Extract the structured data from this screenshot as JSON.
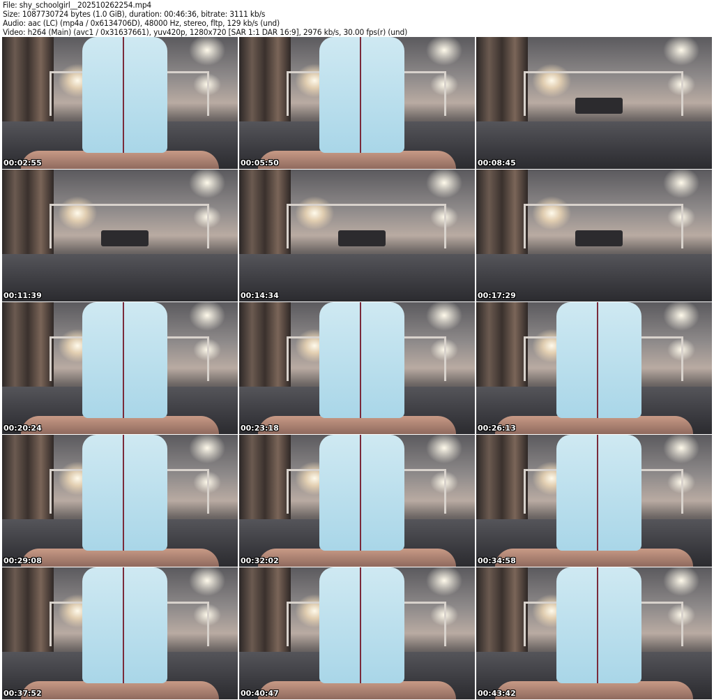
{
  "header": {
    "file": "File: shy_schoolgirl__202510262254.mp4",
    "size": "Size: 1087730724 bytes (1.0 GiB), duration: 00:46:36, bitrate: 3111 kb/s",
    "audio": "Audio: aac (LC) (mp4a / 0x6134706D), 48000 Hz, stereo, fltp, 129 kb/s (und)",
    "video": "Video: h264 (Main) (avc1 / 0x31637661), yuv420p, 1280x720 [SAR 1:1 DAR 16:9], 2976 kb/s, 30.00 fps(r) (und)"
  },
  "thumbnails": [
    {
      "time": "00:02:55",
      "person": true
    },
    {
      "time": "00:05:50",
      "person": true
    },
    {
      "time": "00:08:45",
      "person": false
    },
    {
      "time": "00:11:39",
      "person": false
    },
    {
      "time": "00:14:34",
      "person": false
    },
    {
      "time": "00:17:29",
      "person": false
    },
    {
      "time": "00:20:24",
      "person": true
    },
    {
      "time": "00:23:18",
      "person": true
    },
    {
      "time": "00:26:13",
      "person": true
    },
    {
      "time": "00:29:08",
      "person": true
    },
    {
      "time": "00:32:02",
      "person": true
    },
    {
      "time": "00:34:58",
      "person": true
    },
    {
      "time": "00:37:52",
      "person": true
    },
    {
      "time": "00:40:47",
      "person": true
    },
    {
      "time": "00:43:42",
      "person": true
    }
  ]
}
